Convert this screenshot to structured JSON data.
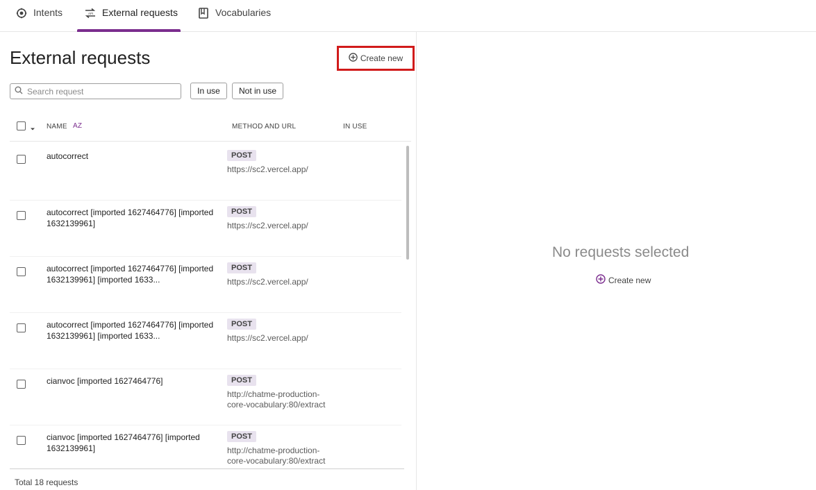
{
  "tabs": [
    {
      "label": "Intents",
      "icon": "intents-icon"
    },
    {
      "label": "External requests",
      "icon": "api-icon"
    },
    {
      "label": "Vocabularies",
      "icon": "book-icon"
    }
  ],
  "accent_color": "#7b2d8e",
  "page_title": "External requests",
  "create_label": "Create new",
  "search": {
    "placeholder": "Search request"
  },
  "filters": {
    "in_use": "In use",
    "not_in_use": "Not in use"
  },
  "table": {
    "headers": {
      "name": "NAME",
      "method_url": "METHOD AND URL",
      "in_use": "IN USE",
      "sort": "AZ"
    },
    "rows": [
      {
        "name": "autocorrect",
        "method": "POST",
        "url": "https://sc2.vercel.app/"
      },
      {
        "name": "autocorrect [imported 1627464776] [imported 1632139961]",
        "method": "POST",
        "url": "https://sc2.vercel.app/"
      },
      {
        "name": "autocorrect [imported 1627464776] [imported 1632139961] [imported 1633...",
        "method": "POST",
        "url": "https://sc2.vercel.app/"
      },
      {
        "name": "autocorrect [imported 1627464776] [imported 1632139961] [imported 1633...",
        "method": "POST",
        "url": "https://sc2.vercel.app/"
      },
      {
        "name": "cianvoc [imported 1627464776]",
        "method": "POST",
        "url": "http://chatme-production-core-vocabulary:80/extract"
      },
      {
        "name": "cianvoc [imported 1627464776] [imported 1632139961]",
        "method": "POST",
        "url": "http://chatme-production-core-vocabulary:80/extract"
      }
    ]
  },
  "footer": "Total 18 requests",
  "empty_state": {
    "title": "No requests selected",
    "create_label": "Create new"
  }
}
